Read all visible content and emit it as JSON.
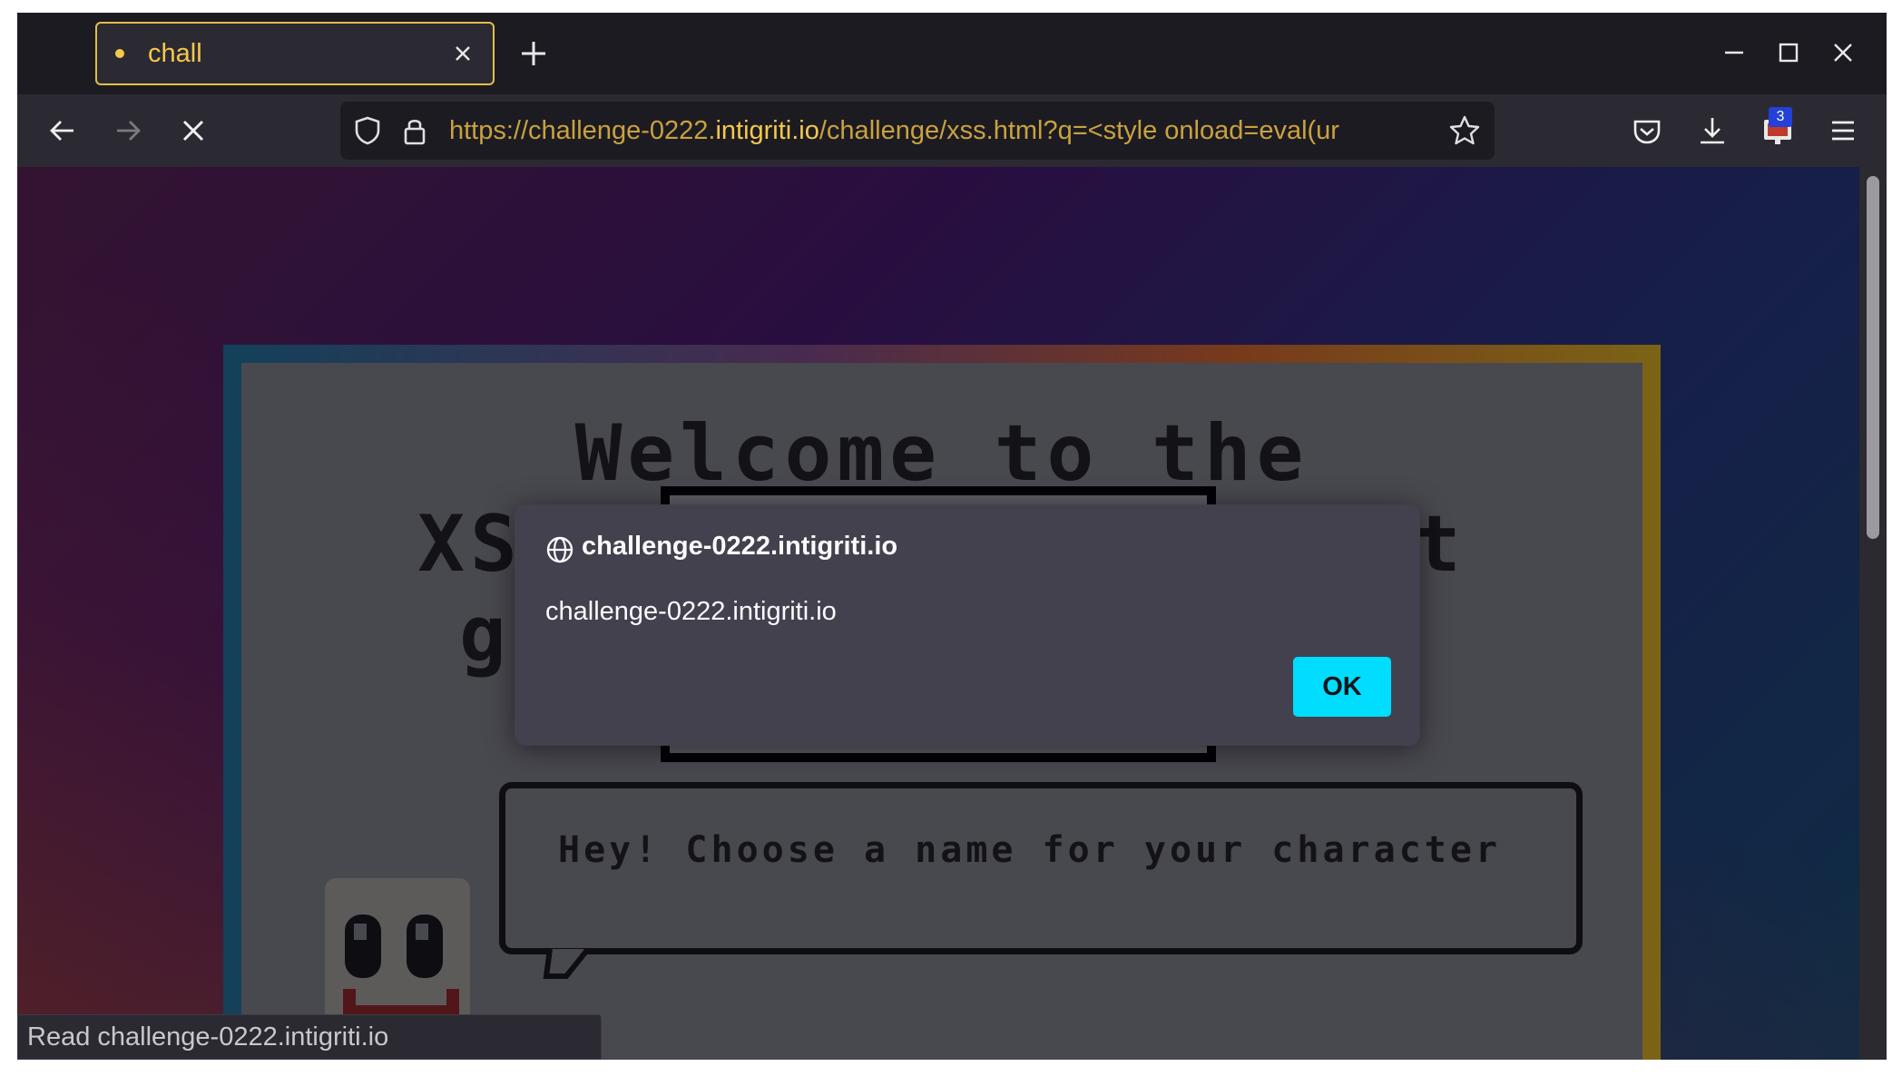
{
  "browser": {
    "tab": {
      "title": "chall"
    },
    "url": {
      "prefix": "https://challenge-0222.",
      "domain": "intigriti.io",
      "rest": "/challenge/xss.html?q=<style onload=eval(ur"
    },
    "extension_badge": "3",
    "status_text": "Read challenge-0222.intigriti.io"
  },
  "page": {
    "headline_line1": "Welcome to the",
    "headline_line2": "XSS               rt",
    "headline_line3": "g",
    "speech_bubble": "Hey! Choose a name for your character"
  },
  "dialog": {
    "title": "challenge-0222.intigriti.io",
    "message": "challenge-0222.intigriti.io",
    "ok_label": "OK"
  },
  "colors": {
    "accent": "#f5c84c",
    "ok_button": "#00ddff",
    "dialog_bg": "#42414d"
  }
}
